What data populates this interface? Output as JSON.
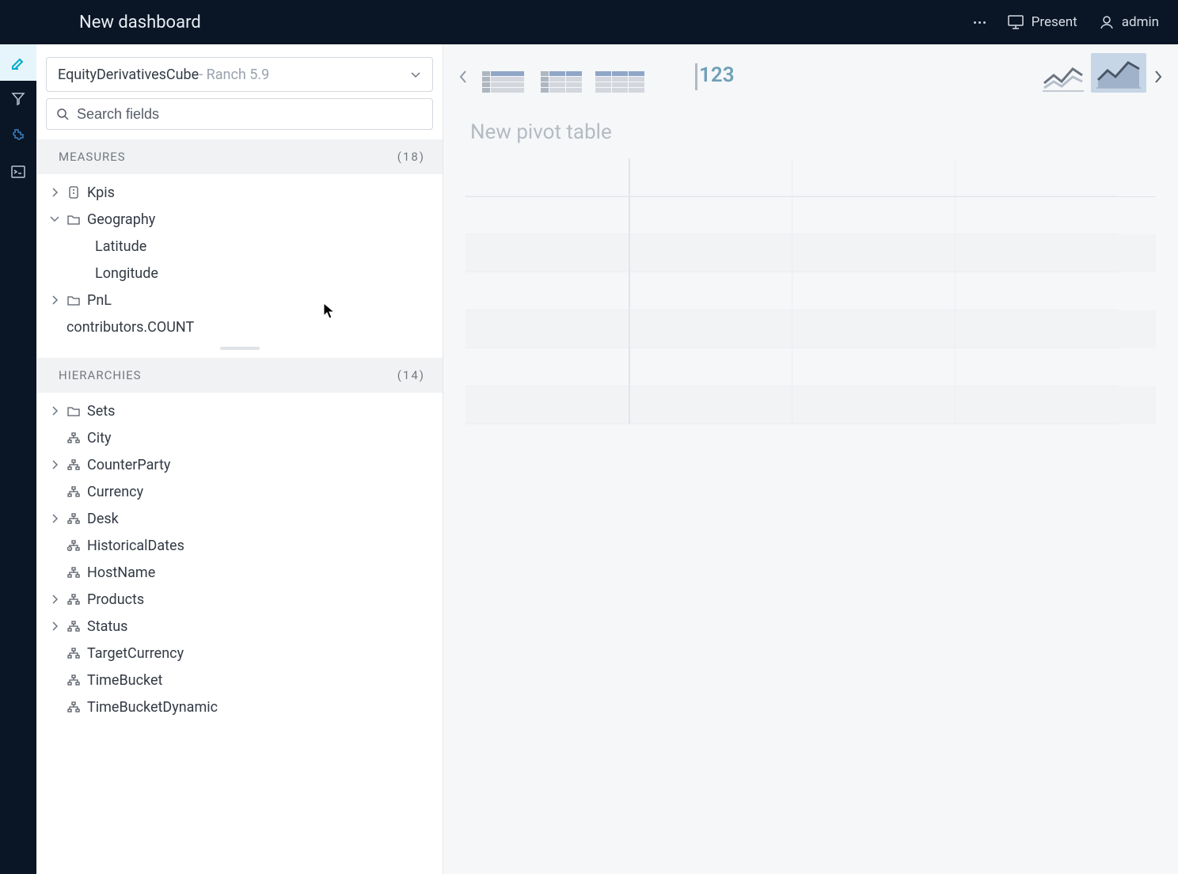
{
  "header": {
    "title": "New dashboard",
    "present_label": "Present",
    "user_label": "admin"
  },
  "sidebar": {
    "cube": {
      "name": "EquityDerivativesCube",
      "suffix": " - Ranch 5.9"
    },
    "search": {
      "placeholder": "Search fields"
    },
    "measures": {
      "label": "MEASURES",
      "count": "(18)",
      "items": [
        {
          "label": "Kpis",
          "icon": "kpi",
          "expandable": true,
          "expanded": false
        },
        {
          "label": "Geography",
          "icon": "folder",
          "expandable": true,
          "expanded": true
        },
        {
          "label": "Latitude",
          "icon": "",
          "expandable": false,
          "indent": 1
        },
        {
          "label": "Longitude",
          "icon": "",
          "expandable": false,
          "indent": 1
        },
        {
          "label": "PnL",
          "icon": "folder",
          "expandable": true,
          "expanded": false
        },
        {
          "label": "contributors.COUNT",
          "icon": "",
          "expandable": false
        }
      ]
    },
    "hierarchies": {
      "label": "HIERARCHIES",
      "count": "(14)",
      "items": [
        {
          "label": "Sets",
          "icon": "folder",
          "expandable": true
        },
        {
          "label": "City",
          "icon": "hierarchy",
          "expandable": false
        },
        {
          "label": "CounterParty",
          "icon": "hierarchy",
          "expandable": true
        },
        {
          "label": "Currency",
          "icon": "hierarchy",
          "expandable": false
        },
        {
          "label": "Desk",
          "icon": "hierarchy",
          "expandable": true
        },
        {
          "label": "HistoricalDates",
          "icon": "hier-time",
          "expandable": false
        },
        {
          "label": "HostName",
          "icon": "hierarchy",
          "expandable": false
        },
        {
          "label": "Products",
          "icon": "hierarchy",
          "expandable": true
        },
        {
          "label": "Status",
          "icon": "hierarchy",
          "expandable": true
        },
        {
          "label": "TargetCurrency",
          "icon": "hierarchy",
          "expandable": false
        },
        {
          "label": "TimeBucket",
          "icon": "hierarchy",
          "expandable": false
        },
        {
          "label": "TimeBucketDynamic",
          "icon": "hierarchy",
          "expandable": false
        }
      ]
    }
  },
  "canvas": {
    "title": "New pivot table",
    "number_viz_label": "123"
  }
}
